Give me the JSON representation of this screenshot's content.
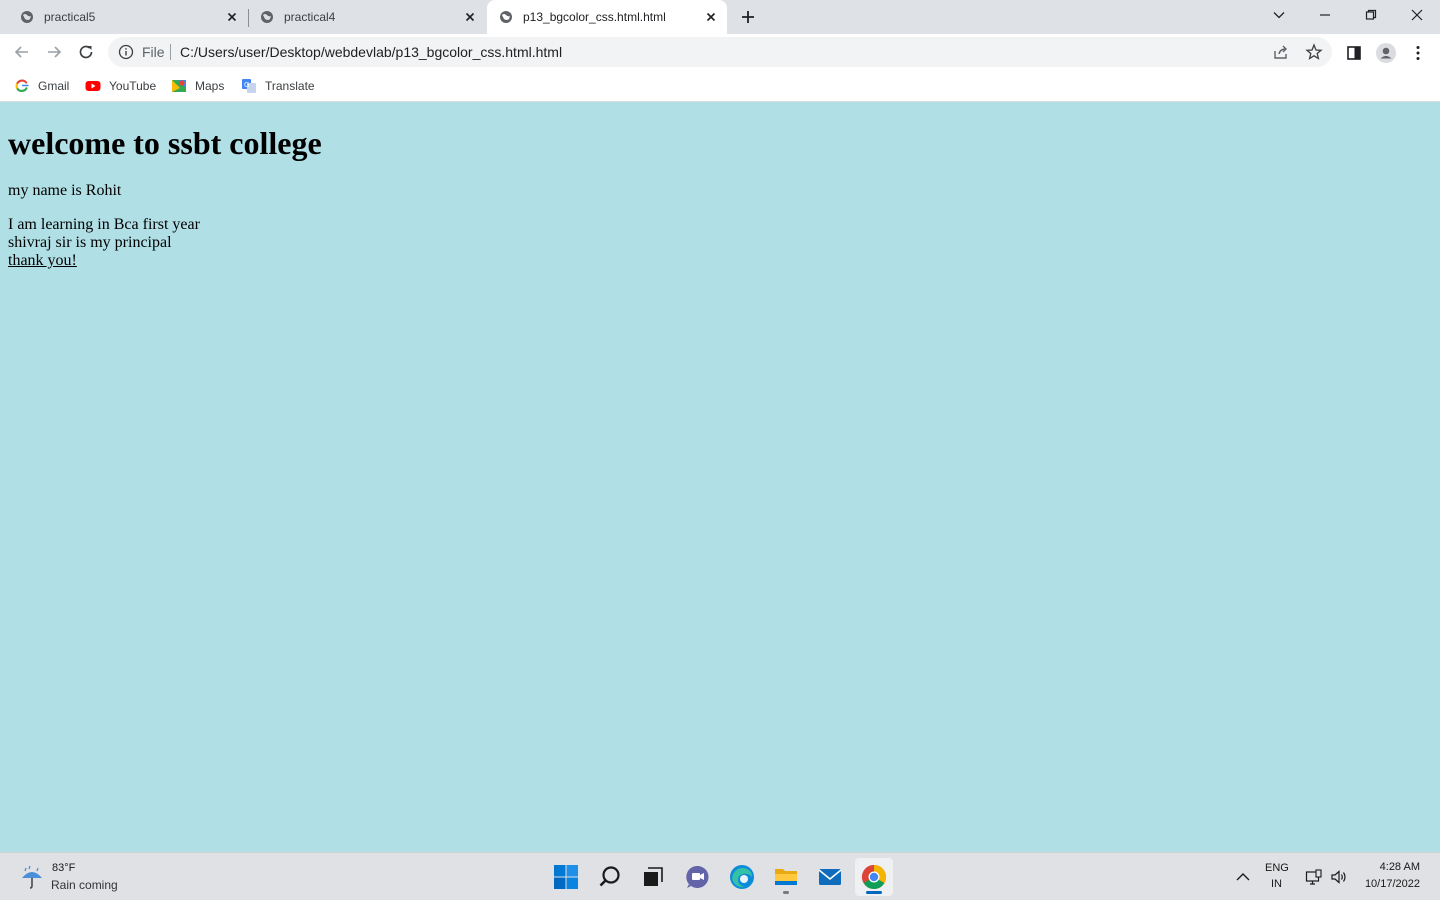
{
  "browser": {
    "tabs": [
      {
        "title": "practical5",
        "active": false
      },
      {
        "title": "practical4",
        "active": false
      },
      {
        "title": "p13_bgcolor_css.html.html",
        "active": true
      }
    ],
    "address": {
      "scheme_label": "File",
      "url": "C:/Users/user/Desktop/webdevlab/p13_bgcolor_css.html.html"
    },
    "bookmarks": [
      {
        "label": "Gmail",
        "icon": "google-icon"
      },
      {
        "label": "YouTube",
        "icon": "youtube-icon"
      },
      {
        "label": "Maps",
        "icon": "maps-icon"
      },
      {
        "label": "Translate",
        "icon": "translate-icon"
      }
    ]
  },
  "page": {
    "background": "#b0dfe5",
    "heading": "welcome to ssbt college",
    "paragraph1": "my name is Rohit",
    "paragraph2_lines": [
      "I am learning in Bca first year",
      "shivraj sir is my principal",
      "thank you!"
    ]
  },
  "taskbar": {
    "weather": {
      "temperature": "83°F",
      "description": "Rain coming"
    },
    "apps": [
      "start-icon",
      "search-icon",
      "task-view-icon",
      "chat-icon",
      "edge-icon",
      "file-explorer-icon",
      "mail-icon",
      "chrome-icon"
    ],
    "language": {
      "line1": "ENG",
      "line2": "IN"
    },
    "clock": {
      "time": "4:28 AM",
      "date": "10/17/2022"
    }
  },
  "colors": {
    "accent": "#0067c0",
    "tabstrip": "#dee1e6",
    "page_bg": "#b0dfe5"
  }
}
